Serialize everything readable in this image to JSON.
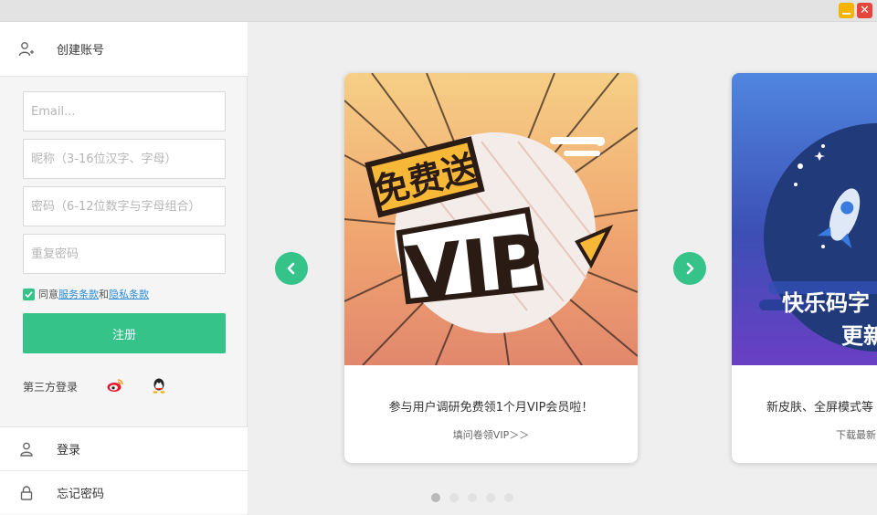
{
  "window": {
    "minimize_label": "",
    "close_label": "✕"
  },
  "sidebar": {
    "header_label": "创建账号",
    "email_placeholder": "Email...",
    "nickname_placeholder": "昵称（3-16位汉字、字母）",
    "password_placeholder": "密码（6-12位数字与字母组合）",
    "repeat_password_placeholder": "重复密码",
    "agree_prefix": "同意",
    "terms_link": "服务条款",
    "agree_and": "和",
    "privacy_link": "隐私条款",
    "register_button": "注册",
    "third_party_label": "第三方登录",
    "login_label": "登录",
    "forgot_label": "忘记密码"
  },
  "carousel": {
    "cards": [
      {
        "banner_text_1": "免费送",
        "banner_text_2": "VIP",
        "title": "参与用户调研免费领1个月VIP会员啦！",
        "link": "填问卷领VIP＞＞"
      },
      {
        "banner_text_1": "快乐码字",
        "banner_text_2": "更新",
        "title": "新皮肤、全屏模式等",
        "link": "下载最新"
      }
    ],
    "dots_count": 5,
    "active_dot": 0
  },
  "colors": {
    "accent": "#35c38a",
    "link": "#2a8cd8"
  }
}
